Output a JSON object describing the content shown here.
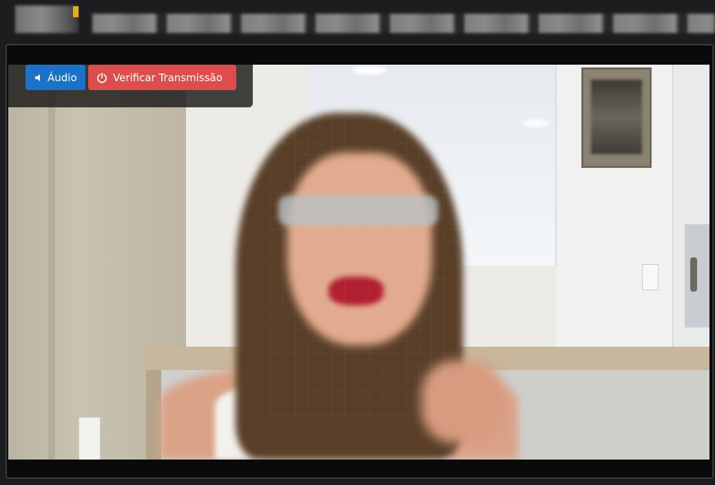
{
  "controls": {
    "audio_label": "Áudio",
    "verify_label": "Verificar Transmissão"
  },
  "icons": {
    "audio": "speaker-icon",
    "verify": "power-icon"
  },
  "colors": {
    "audio_button": "#1a73c8",
    "verify_button": "#dc4d4b",
    "background": "#1b1c1e"
  }
}
